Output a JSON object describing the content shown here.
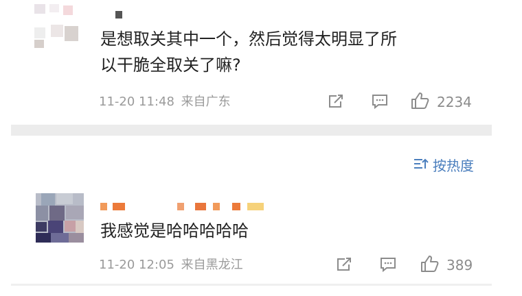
{
  "comments": [
    {
      "text_line1": "是想取关其中一个，然后觉得太明显了所",
      "text_line2": "以干脆全取关了嘛?",
      "time": "11-20 11:48",
      "location": "来自广东",
      "likes": "2234"
    },
    {
      "text": "我感觉是哈哈哈哈哈",
      "time": "11-20 12:05",
      "location": "来自黑龙江",
      "likes": "389"
    }
  ],
  "sort": {
    "label": "按热度",
    "icon": "sort-icon"
  },
  "icons": {
    "share": "share-icon",
    "reply": "comment-icon",
    "like": "thumbs-up-icon"
  },
  "colors": {
    "link": "#4a7ebd",
    "meta": "#9a9a9a",
    "divider": "#ececec"
  }
}
